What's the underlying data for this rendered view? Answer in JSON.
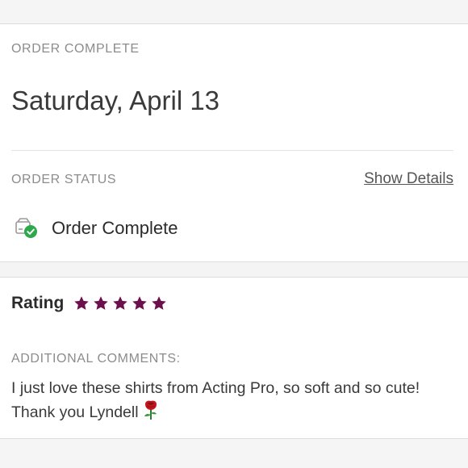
{
  "order": {
    "header_label": "ORDER COMPLETE",
    "date": "Saturday, April 13",
    "status_label": "ORDER STATUS",
    "show_details_label": "Show Details",
    "status_text": "Order Complete",
    "status_icon": "box-check-icon"
  },
  "rating": {
    "label": "Rating",
    "stars": 5,
    "max_stars": 5,
    "star_color": "#6b0f4d",
    "comments_label": "ADDITIONAL COMMENTS:",
    "comment": "I just love these shirts from Acting Pro, so soft and so cute! Thank you Lyndell",
    "comment_emoji_icon": "rose-icon"
  },
  "colors": {
    "check_green": "#2ea84a",
    "muted_text": "#8c8c8c"
  }
}
